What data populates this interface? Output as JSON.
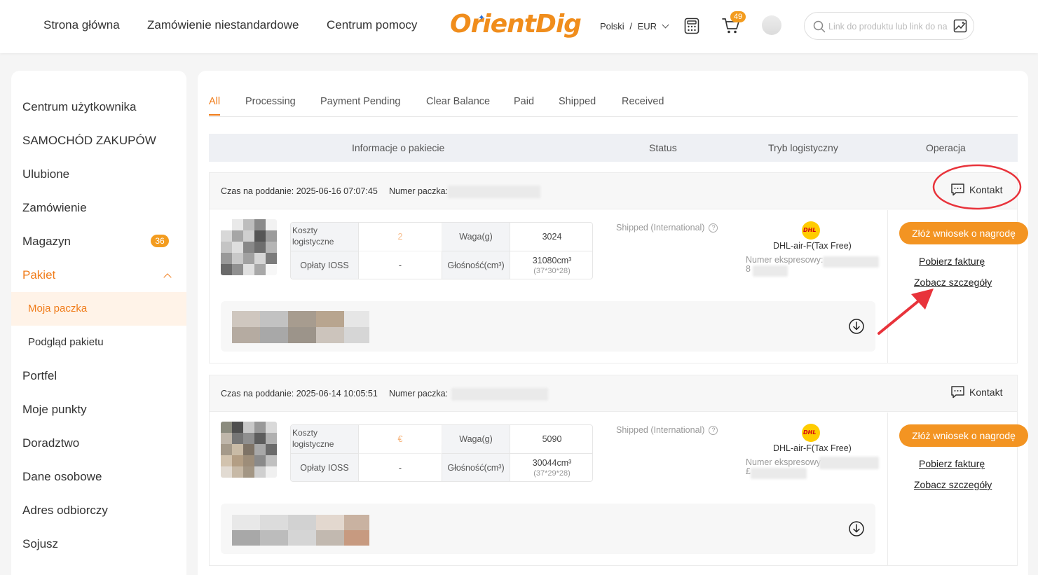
{
  "header": {
    "nav": [
      "Strona główna",
      "Zamówienie niestandardowe",
      "Centrum pomocy"
    ],
    "logo_text": "OrientDig",
    "language": "Polski",
    "separator": "/",
    "currency": "EUR",
    "cart_count": "49",
    "search_placeholder": "Link do produktu lub link do na"
  },
  "sidebar": {
    "items": [
      {
        "label": "Centrum użytkownika"
      },
      {
        "label": "SAMOCHÓD ZAKUPÓW"
      },
      {
        "label": "Ulubione"
      },
      {
        "label": "Zamówienie"
      },
      {
        "label": "Magazyn",
        "badge": "36"
      },
      {
        "label": "Pakiet"
      },
      {
        "label": "Moja paczka"
      },
      {
        "label": "Podgląd pakietu"
      },
      {
        "label": "Portfel"
      },
      {
        "label": "Moje punkty"
      },
      {
        "label": "Doradztwo"
      },
      {
        "label": "Dane osobowe"
      },
      {
        "label": "Adres odbiorczy"
      },
      {
        "label": "Sojusz"
      }
    ]
  },
  "tabs": [
    "All",
    "Processing",
    "Payment Pending",
    "Clear Balance",
    "Paid",
    "Shipped",
    "Received"
  ],
  "table_headers": [
    "Informacje o pakiecie",
    "Status",
    "Tryb logistyczny",
    "Operacja"
  ],
  "labels": {
    "package_number": "Numer paczka:",
    "contact": "Kontakt",
    "logistics_cost": "Koszty logistyczne",
    "weight": "Waga(g)",
    "ioss": "Opłaty IOSS",
    "volume": "Głośność(cm³)",
    "express_number": "Numer ekspresowy:",
    "reward_button": "Złóż wniosek o nagrodę",
    "invoice_link": "Pobierz fakturę",
    "details_link": "Zobacz szczegóły",
    "carrier_logo": "DHL"
  },
  "packages": [
    {
      "time": "Czas na poddanie: 2025-06-16 07:07:45",
      "logistics_cost_value": "2",
      "ioss_value": "-",
      "weight_value": "3024",
      "volume_value": "31080cm³",
      "volume_dims": "(37*30*28)",
      "status": "Shipped (International)",
      "logistics_mode": "DHL-air-F(Tax Free)",
      "express_prefix": "8"
    },
    {
      "time": "Czas na poddanie: 2025-06-14 10:05:51",
      "logistics_cost_value": "€",
      "ioss_value": "-",
      "weight_value": "5090",
      "volume_value": "30044cm³",
      "volume_dims": "(37*29*28)",
      "status": "Shipped (International)",
      "logistics_mode": "DHL-air-F(Tax Free)",
      "express_prefix": "£"
    }
  ],
  "colors": {
    "accent": "#f07c1a",
    "button": "#f39422",
    "annotation": "#e8333b",
    "dhl_yellow": "#ffcc00",
    "dhl_red": "#d40511"
  }
}
